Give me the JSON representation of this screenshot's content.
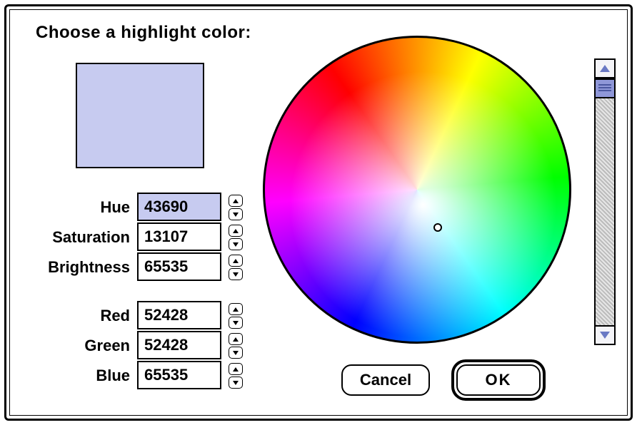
{
  "title": "Choose a highlight color:",
  "swatch_color": "#c7cbf0",
  "hsb": {
    "hue": {
      "label": "Hue",
      "value": "43690"
    },
    "saturation": {
      "label": "Saturation",
      "value": "13107"
    },
    "brightness": {
      "label": "Brightness",
      "value": "65535"
    }
  },
  "rgb": {
    "red": {
      "label": "Red",
      "value": "52428"
    },
    "green": {
      "label": "Green",
      "value": "52428"
    },
    "blue": {
      "label": "Blue",
      "value": "65535"
    }
  },
  "buttons": {
    "cancel": "Cancel",
    "ok": "OK"
  }
}
